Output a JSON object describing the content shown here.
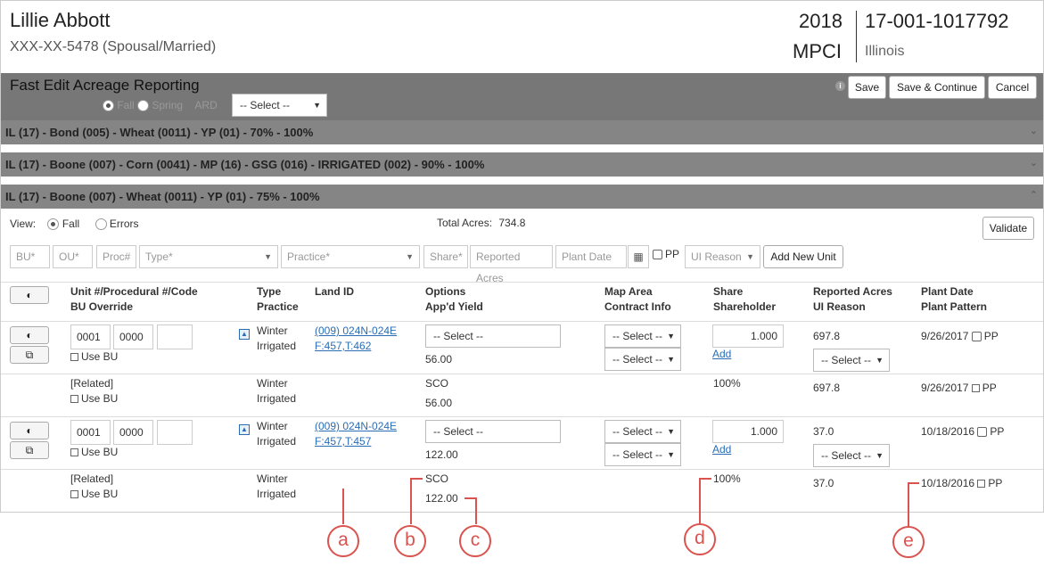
{
  "header": {
    "name": "Lillie Abbott",
    "ssn": "XXX-XX-5478 (Spousal/Married)",
    "year": "2018",
    "plan": "MPCI",
    "policy": "17-001-1017792",
    "state": "Illinois"
  },
  "toolbar": {
    "title": "Fast Edit Acreage Reporting",
    "fall_label": "Fall",
    "spring_label": "Spring",
    "ard_label": "ARD",
    "ard_select": "-- Select --",
    "save_label": "Save",
    "save_continue_label": "Save & Continue",
    "cancel_label": "Cancel"
  },
  "units": [
    {
      "title": "IL (17) - Bond (005) - Wheat (0011) - YP (01) - 70% - 100%"
    },
    {
      "title": "IL (17) - Boone (007) - Corn (0041) - MP (16) - GSG (016) - IRRIGATED (002) - 90% - 100%"
    },
    {
      "title": "IL (17) - Boone (007) - Wheat (0011) - YP (01) - 75% - 100%"
    }
  ],
  "panel": {
    "view_label": "View:",
    "view_fall": "Fall",
    "view_errors": "Errors",
    "total_acres_label": "Total Acres:",
    "total_acres_value": "734.8",
    "validate_label": "Validate"
  },
  "add_form": {
    "bu": "BU*",
    "ou": "OU*",
    "proc": "Proc#",
    "type": "Type*",
    "practice": "Practice*",
    "share": "Share*",
    "reported_acres": "Reported Acres",
    "plant_date": "Plant Date",
    "pp": "PP",
    "ui_reason": "UI Reason",
    "add_label": "Add New Unit"
  },
  "columns": {
    "unit_1": "Unit #/Procedural #/Code",
    "unit_2": "BU Override",
    "type_1": "Type",
    "type_2": "Practice",
    "land": "Land ID",
    "options_1": "Options",
    "options_2": "App'd Yield",
    "map_1": "Map Area",
    "map_2": "Contract Info",
    "share_1": "Share",
    "share_2": "Shareholder",
    "acres_1": "Reported Acres",
    "acres_2": "UI Reason",
    "plant_1": "Plant Date",
    "plant_2": "Plant Pattern"
  },
  "rows": [
    {
      "unit": "0001",
      "proc": "0000",
      "use_bu": "Use BU",
      "type": "Winter",
      "practice": "Irrigated",
      "land_1": "(009) 024N-024E",
      "land_2": "F:457,T:462",
      "options": "-- Select --",
      "yield": "56.00",
      "map": "-- Select --",
      "contract": "-- Select --",
      "share": "1.000",
      "add": "Add",
      "acres": "697.8",
      "ui": "-- Select --",
      "plant_date": "9/26/2017",
      "pp": "PP"
    },
    {
      "related": "[Related]",
      "use_bu": "Use BU",
      "type": "Winter",
      "practice": "Irrigated",
      "options": "SCO",
      "yield": "56.00",
      "share": "100%",
      "acres": "697.8",
      "plant_date": "9/26/2017",
      "pp": "PP"
    },
    {
      "unit": "0001",
      "proc": "0000",
      "use_bu": "Use BU",
      "type": "Winter",
      "practice": "Irrigated",
      "land_1": "(009) 024N-024E",
      "land_2": "F:457,T:457",
      "options": "-- Select --",
      "yield": "122.00",
      "map": "-- Select --",
      "contract": "-- Select --",
      "share": "1.000",
      "add": "Add",
      "acres": "37.0",
      "ui": "-- Select --",
      "plant_date": "10/18/2016",
      "pp": "PP"
    },
    {
      "related": "[Related]",
      "use_bu": "Use BU",
      "type": "Winter",
      "practice": "Irrigated",
      "options": "SCO",
      "yield": "122.00",
      "share": "100%",
      "acres": "37.0",
      "plant_date": "10/18/2016",
      "pp": "PP"
    }
  ],
  "callouts": [
    "a",
    "b",
    "c",
    "d",
    "e"
  ],
  "colors": {
    "accent": "#d9534f",
    "link": "#2a6db5",
    "bar": "#858585",
    "toolbar": "#777777"
  }
}
